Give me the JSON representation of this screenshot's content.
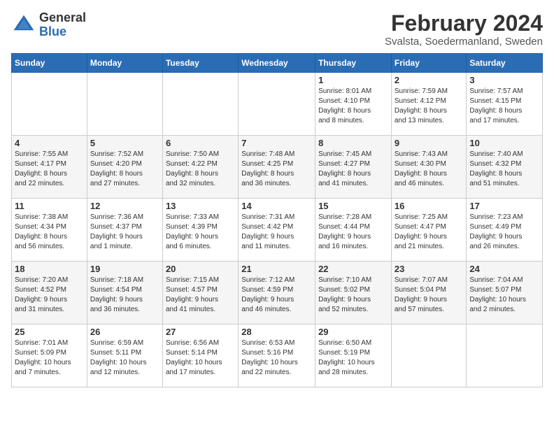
{
  "header": {
    "logo_general": "General",
    "logo_blue": "Blue",
    "month_title": "February 2024",
    "subtitle": "Svalsta, Soedermanland, Sweden"
  },
  "weekdays": [
    "Sunday",
    "Monday",
    "Tuesday",
    "Wednesday",
    "Thursday",
    "Friday",
    "Saturday"
  ],
  "weeks": [
    [
      {
        "day": "",
        "info": ""
      },
      {
        "day": "",
        "info": ""
      },
      {
        "day": "",
        "info": ""
      },
      {
        "day": "",
        "info": ""
      },
      {
        "day": "1",
        "info": "Sunrise: 8:01 AM\nSunset: 4:10 PM\nDaylight: 8 hours\nand 8 minutes."
      },
      {
        "day": "2",
        "info": "Sunrise: 7:59 AM\nSunset: 4:12 PM\nDaylight: 8 hours\nand 13 minutes."
      },
      {
        "day": "3",
        "info": "Sunrise: 7:57 AM\nSunset: 4:15 PM\nDaylight: 8 hours\nand 17 minutes."
      }
    ],
    [
      {
        "day": "4",
        "info": "Sunrise: 7:55 AM\nSunset: 4:17 PM\nDaylight: 8 hours\nand 22 minutes."
      },
      {
        "day": "5",
        "info": "Sunrise: 7:52 AM\nSunset: 4:20 PM\nDaylight: 8 hours\nand 27 minutes."
      },
      {
        "day": "6",
        "info": "Sunrise: 7:50 AM\nSunset: 4:22 PM\nDaylight: 8 hours\nand 32 minutes."
      },
      {
        "day": "7",
        "info": "Sunrise: 7:48 AM\nSunset: 4:25 PM\nDaylight: 8 hours\nand 36 minutes."
      },
      {
        "day": "8",
        "info": "Sunrise: 7:45 AM\nSunset: 4:27 PM\nDaylight: 8 hours\nand 41 minutes."
      },
      {
        "day": "9",
        "info": "Sunrise: 7:43 AM\nSunset: 4:30 PM\nDaylight: 8 hours\nand 46 minutes."
      },
      {
        "day": "10",
        "info": "Sunrise: 7:40 AM\nSunset: 4:32 PM\nDaylight: 8 hours\nand 51 minutes."
      }
    ],
    [
      {
        "day": "11",
        "info": "Sunrise: 7:38 AM\nSunset: 4:34 PM\nDaylight: 8 hours\nand 56 minutes."
      },
      {
        "day": "12",
        "info": "Sunrise: 7:36 AM\nSunset: 4:37 PM\nDaylight: 9 hours\nand 1 minute."
      },
      {
        "day": "13",
        "info": "Sunrise: 7:33 AM\nSunset: 4:39 PM\nDaylight: 9 hours\nand 6 minutes."
      },
      {
        "day": "14",
        "info": "Sunrise: 7:31 AM\nSunset: 4:42 PM\nDaylight: 9 hours\nand 11 minutes."
      },
      {
        "day": "15",
        "info": "Sunrise: 7:28 AM\nSunset: 4:44 PM\nDaylight: 9 hours\nand 16 minutes."
      },
      {
        "day": "16",
        "info": "Sunrise: 7:25 AM\nSunset: 4:47 PM\nDaylight: 9 hours\nand 21 minutes."
      },
      {
        "day": "17",
        "info": "Sunrise: 7:23 AM\nSunset: 4:49 PM\nDaylight: 9 hours\nand 26 minutes."
      }
    ],
    [
      {
        "day": "18",
        "info": "Sunrise: 7:20 AM\nSunset: 4:52 PM\nDaylight: 9 hours\nand 31 minutes."
      },
      {
        "day": "19",
        "info": "Sunrise: 7:18 AM\nSunset: 4:54 PM\nDaylight: 9 hours\nand 36 minutes."
      },
      {
        "day": "20",
        "info": "Sunrise: 7:15 AM\nSunset: 4:57 PM\nDaylight: 9 hours\nand 41 minutes."
      },
      {
        "day": "21",
        "info": "Sunrise: 7:12 AM\nSunset: 4:59 PM\nDaylight: 9 hours\nand 46 minutes."
      },
      {
        "day": "22",
        "info": "Sunrise: 7:10 AM\nSunset: 5:02 PM\nDaylight: 9 hours\nand 52 minutes."
      },
      {
        "day": "23",
        "info": "Sunrise: 7:07 AM\nSunset: 5:04 PM\nDaylight: 9 hours\nand 57 minutes."
      },
      {
        "day": "24",
        "info": "Sunrise: 7:04 AM\nSunset: 5:07 PM\nDaylight: 10 hours\nand 2 minutes."
      }
    ],
    [
      {
        "day": "25",
        "info": "Sunrise: 7:01 AM\nSunset: 5:09 PM\nDaylight: 10 hours\nand 7 minutes."
      },
      {
        "day": "26",
        "info": "Sunrise: 6:59 AM\nSunset: 5:11 PM\nDaylight: 10 hours\nand 12 minutes."
      },
      {
        "day": "27",
        "info": "Sunrise: 6:56 AM\nSunset: 5:14 PM\nDaylight: 10 hours\nand 17 minutes."
      },
      {
        "day": "28",
        "info": "Sunrise: 6:53 AM\nSunset: 5:16 PM\nDaylight: 10 hours\nand 22 minutes."
      },
      {
        "day": "29",
        "info": "Sunrise: 6:50 AM\nSunset: 5:19 PM\nDaylight: 10 hours\nand 28 minutes."
      },
      {
        "day": "",
        "info": ""
      },
      {
        "day": "",
        "info": ""
      }
    ]
  ]
}
